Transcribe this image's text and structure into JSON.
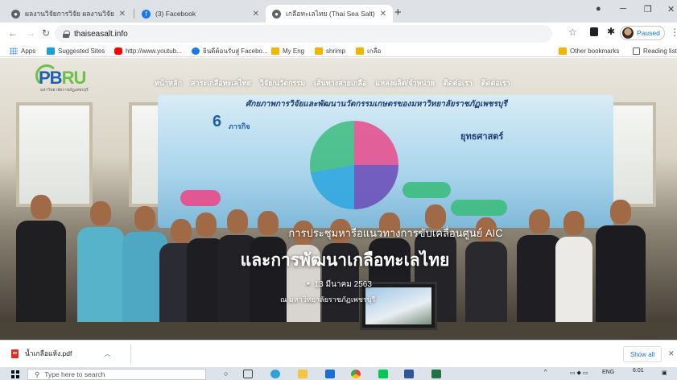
{
  "tabs": [
    {
      "title": "ผลงานวิจัยการวิจัย ผลงานวิจัยและนวัตกรรม มีผลงานวิจัย",
      "favicon": "globe-icon",
      "active": false
    },
    {
      "title": "(3) Facebook",
      "favicon": "facebook-icon",
      "active": false
    },
    {
      "title": "เกลือทะเลไทย (Thai Sea Salt)",
      "favicon": "globe-icon",
      "active": true
    }
  ],
  "toolbar": {
    "url": "thaiseasalt.info",
    "profile_status": "Paused"
  },
  "bookmarks": {
    "items": [
      {
        "label": "Apps",
        "icon": "apps-grid-icon"
      },
      {
        "label": "Suggested Sites",
        "icon": "suggested-sites-icon"
      },
      {
        "label": "http://www.youtub...",
        "icon": "youtube-icon"
      },
      {
        "label": "ยินดีต้อนรับสู่ Facebo...",
        "icon": "facebook-icon"
      },
      {
        "label": "My Eng",
        "icon": "folder-icon"
      },
      {
        "label": "shrimp",
        "icon": "folder-icon"
      },
      {
        "label": "เกลือ",
        "icon": "folder-icon"
      }
    ],
    "other": "Other bookmarks",
    "reading_list": "Reading list"
  },
  "site": {
    "logo_text_a": "PB",
    "logo_text_b": "RU",
    "logo_subtitle": "มหาวิทยาลัยราชภัฏเพชรบุรี",
    "nav": [
      "หน้าหลัก",
      "สาระเกลือทะเลไทย",
      "วิจัย/นวัตกรรม",
      "เส้นทางสายเกลือ",
      "แหล่งผลิต/จำหน่าย",
      "ติดต่อเรา",
      "ติดต่อเรา"
    ]
  },
  "banner": {
    "title": "ศักยภาพการวิจัยและพัฒนานวัตกรรมเกษตรของมหาวิทยาลัยราชภัฏเพชรบุรี",
    "number": "6",
    "number_suffix": "ภารกิจ",
    "right_label": "ยุทธศาสตร์"
  },
  "hero": {
    "line1": "การประชุมหารือแนวทางการขับเคลื่อนศูนย์ AIC",
    "line2": "และการพัฒนาเกลือทะเลไทย",
    "line3": "13 มีนาคม 2563",
    "line4": "ณ มหาวิทยาลัยราชภัฏเพชรบุรี"
  },
  "downloads": {
    "file_name": "น้ำเกลือแห้ง.pdf",
    "show_all": "Show all"
  },
  "taskbar": {
    "search_placeholder": "Type here to search",
    "language": "ENG",
    "time": "6:01"
  },
  "colors": {
    "tabstrip": "#dee1e6",
    "accent_blue": "#1a73e8",
    "folder": "#f4b400",
    "taskbar": "#dde3ea"
  }
}
